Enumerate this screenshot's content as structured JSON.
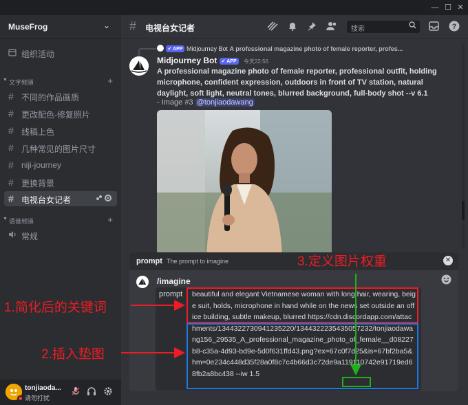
{
  "window": {
    "min": "—",
    "max": "☐",
    "close": "✕"
  },
  "server": {
    "name": "MuseFrog",
    "chevron": "⌄"
  },
  "sidebar": {
    "events": "组织活动",
    "category_text": "文字频道",
    "category_voice": "语音频道",
    "channels": [
      "不同的作品画质",
      "更改配色-修复照片",
      "线稿上色",
      "几种常见的图片尺寸",
      "niji-journey",
      "更换背景",
      "电视台女记者"
    ],
    "voice_channels": [
      "常规"
    ]
  },
  "user": {
    "name": "tonjiaoda...",
    "status": "请勿打扰"
  },
  "header": {
    "channel": "电视台女记者",
    "search_placeholder": "搜索"
  },
  "reply": {
    "author": "Midjourney Bot",
    "badge": "✔ APP",
    "text": "A professional magazine photo of female reporter, profes..."
  },
  "message": {
    "author": "Midjourney Bot",
    "badge": "✔ APP",
    "timestamp": "今天22:56",
    "content": "A professional magazine photo of female reporter, professional outfit, holding microphone, confident expression, outdoors in front of TV station, natural daylight, soft light, neutral tones, blurred background, full-body shot --v 6.1",
    "suffix": "- Image #3",
    "mention": "@tonjiaodawang"
  },
  "command": {
    "hint_name": "prompt",
    "hint_desc": "The prompt to imagine",
    "name": "/imagine",
    "param_label": "prompt",
    "value_text": "beautiful and elegant Vietnamese woman with long hair, wearing, beige suit, holds, microphone in hand while on the news set outside an office building, subtle makeup, blurred",
    "value_url": "https://cdn.discordapp.com/attachments/1344322730941235220/1344322235435057232/tonjiaodawang156_29535_A_professional_magazine_photo_of_female__d08227b8-c35a-4d93-bd9e-5d0f631ffd43.png?ex=67c0f7d25&is=67bf2ba5&hm=0e234c448d35f28a0f8c7c4b66d3c72de9a119110742e91719ed68fb2a8bc438",
    "value_iw": "--iw 1.5"
  },
  "annotations": {
    "label1": "1.简化后的关键词",
    "label2": "2.插入垫图",
    "label3": "3.定义图片权重"
  },
  "colors": {
    "red": "#ee1c25",
    "blue": "#1a78e6",
    "green": "#1fb01f"
  }
}
